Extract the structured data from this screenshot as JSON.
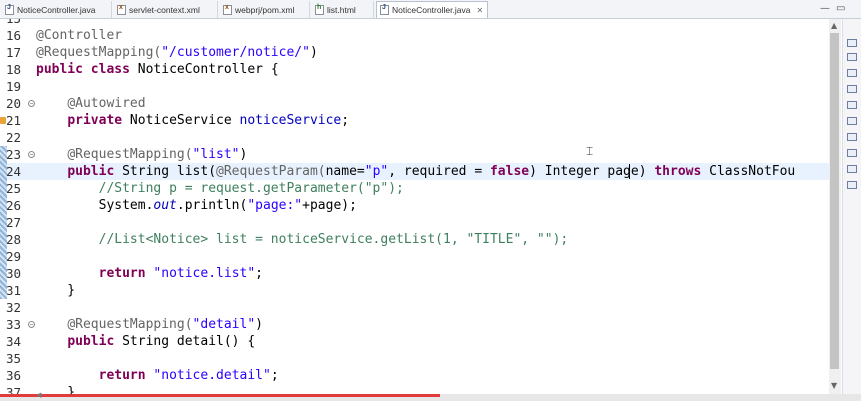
{
  "tabs": [
    {
      "label": "NoticeController.java",
      "icon": "java-file-icon",
      "active": false
    },
    {
      "label": "servlet-context.xml",
      "icon": "xml-file-icon",
      "active": false
    },
    {
      "label": "webprj/pom.xml",
      "icon": "xml-file-icon",
      "active": false
    },
    {
      "label": "list.html",
      "icon": "html-file-icon",
      "active": false
    },
    {
      "label": "NoticeController.java",
      "icon": "java-file-icon",
      "active": true,
      "close": "✕"
    }
  ],
  "window_controls": {
    "minimize": "—",
    "maximize": "▭"
  },
  "editor": {
    "top_partial_line": "15",
    "lines": [
      {
        "num": "16",
        "segments": [
          {
            "t": "@Controller",
            "c": "an"
          }
        ]
      },
      {
        "num": "17",
        "segments": [
          {
            "t": "@RequestMapping(",
            "c": "an"
          },
          {
            "t": "\"/customer/notice/\"",
            "c": "str"
          },
          {
            "t": ")",
            "c": ""
          }
        ]
      },
      {
        "num": "18",
        "segments": [
          {
            "t": "public",
            "c": "kw"
          },
          {
            "t": " ",
            "c": ""
          },
          {
            "t": "class",
            "c": "kw"
          },
          {
            "t": " NoticeController {",
            "c": ""
          }
        ]
      },
      {
        "num": "19",
        "segments": []
      },
      {
        "num": "20",
        "segments": [
          {
            "t": "    ",
            "c": ""
          },
          {
            "t": "@Autowired",
            "c": "an"
          }
        ]
      },
      {
        "num": "21",
        "segments": [
          {
            "t": "    ",
            "c": ""
          },
          {
            "t": "private",
            "c": "kw"
          },
          {
            "t": " NoticeService ",
            "c": ""
          },
          {
            "t": "noticeService",
            "c": "fld"
          },
          {
            "t": ";",
            "c": ""
          }
        ]
      },
      {
        "num": "22",
        "segments": []
      },
      {
        "num": "23",
        "segments": [
          {
            "t": "    ",
            "c": ""
          },
          {
            "t": "@RequestMapping(",
            "c": "an"
          },
          {
            "t": "\"list\"",
            "c": "str"
          },
          {
            "t": ")",
            "c": ""
          }
        ]
      },
      {
        "num": "24",
        "segments": [
          {
            "t": "    ",
            "c": ""
          },
          {
            "t": "public",
            "c": "kw"
          },
          {
            "t": " String list(",
            "c": ""
          },
          {
            "t": "@RequestParam(",
            "c": "an"
          },
          {
            "t": "name=",
            "c": ""
          },
          {
            "t": "\"p\"",
            "c": "str"
          },
          {
            "t": ", required = ",
            "c": ""
          },
          {
            "t": "false",
            "c": "kw"
          },
          {
            "t": ") Integer page) ",
            "c": ""
          },
          {
            "t": "throws",
            "c": "kw"
          },
          {
            "t": " ClassNotFou",
            "c": ""
          }
        ]
      },
      {
        "num": "25",
        "segments": [
          {
            "t": "        ",
            "c": ""
          },
          {
            "t": "//String p = request.getParameter(\"p\");",
            "c": "cm"
          }
        ]
      },
      {
        "num": "26",
        "segments": [
          {
            "t": "        System.",
            "c": ""
          },
          {
            "t": "out",
            "c": "sfld"
          },
          {
            "t": ".println(",
            "c": ""
          },
          {
            "t": "\"page:\"",
            "c": "str"
          },
          {
            "t": "+page);",
            "c": ""
          }
        ]
      },
      {
        "num": "27",
        "segments": []
      },
      {
        "num": "28",
        "segments": [
          {
            "t": "        ",
            "c": ""
          },
          {
            "t": "//List<Notice> list = noticeService.getList(1, \"TITLE\", \"\");",
            "c": "cm"
          }
        ]
      },
      {
        "num": "29",
        "segments": []
      },
      {
        "num": "30",
        "segments": [
          {
            "t": "        ",
            "c": ""
          },
          {
            "t": "return",
            "c": "kw"
          },
          {
            "t": " ",
            "c": ""
          },
          {
            "t": "\"notice.list\"",
            "c": "str"
          },
          {
            "t": ";",
            "c": ""
          }
        ]
      },
      {
        "num": "31",
        "segments": [
          {
            "t": "    }",
            "c": ""
          }
        ]
      },
      {
        "num": "32",
        "segments": []
      },
      {
        "num": "33",
        "segments": [
          {
            "t": "    ",
            "c": ""
          },
          {
            "t": "@RequestMapping(",
            "c": "an"
          },
          {
            "t": "\"detail\"",
            "c": "str"
          },
          {
            "t": ")",
            "c": ""
          }
        ]
      },
      {
        "num": "34",
        "segments": [
          {
            "t": "    ",
            "c": ""
          },
          {
            "t": "public",
            "c": "kw"
          },
          {
            "t": " String detail() {",
            "c": ""
          }
        ]
      },
      {
        "num": "35",
        "segments": []
      },
      {
        "num": "36",
        "segments": [
          {
            "t": "        ",
            "c": ""
          },
          {
            "t": "return",
            "c": "kw"
          },
          {
            "t": " ",
            "c": ""
          },
          {
            "t": "\"notice.detail\"",
            "c": "str"
          },
          {
            "t": ";",
            "c": ""
          }
        ]
      },
      {
        "num": "37",
        "segments": [
          {
            "t": "    }",
            "c": ""
          }
        ]
      }
    ]
  },
  "scroll": {
    "up": "▲",
    "down": "▼",
    "left": "◀"
  },
  "colors": {
    "keyword": "#7f0055",
    "annotation": "#646464",
    "string": "#2a00ff",
    "comment": "#3f7f5f",
    "field": "#0000c0",
    "current_line": "#e8f2fe",
    "progress": "#e23b3b"
  }
}
